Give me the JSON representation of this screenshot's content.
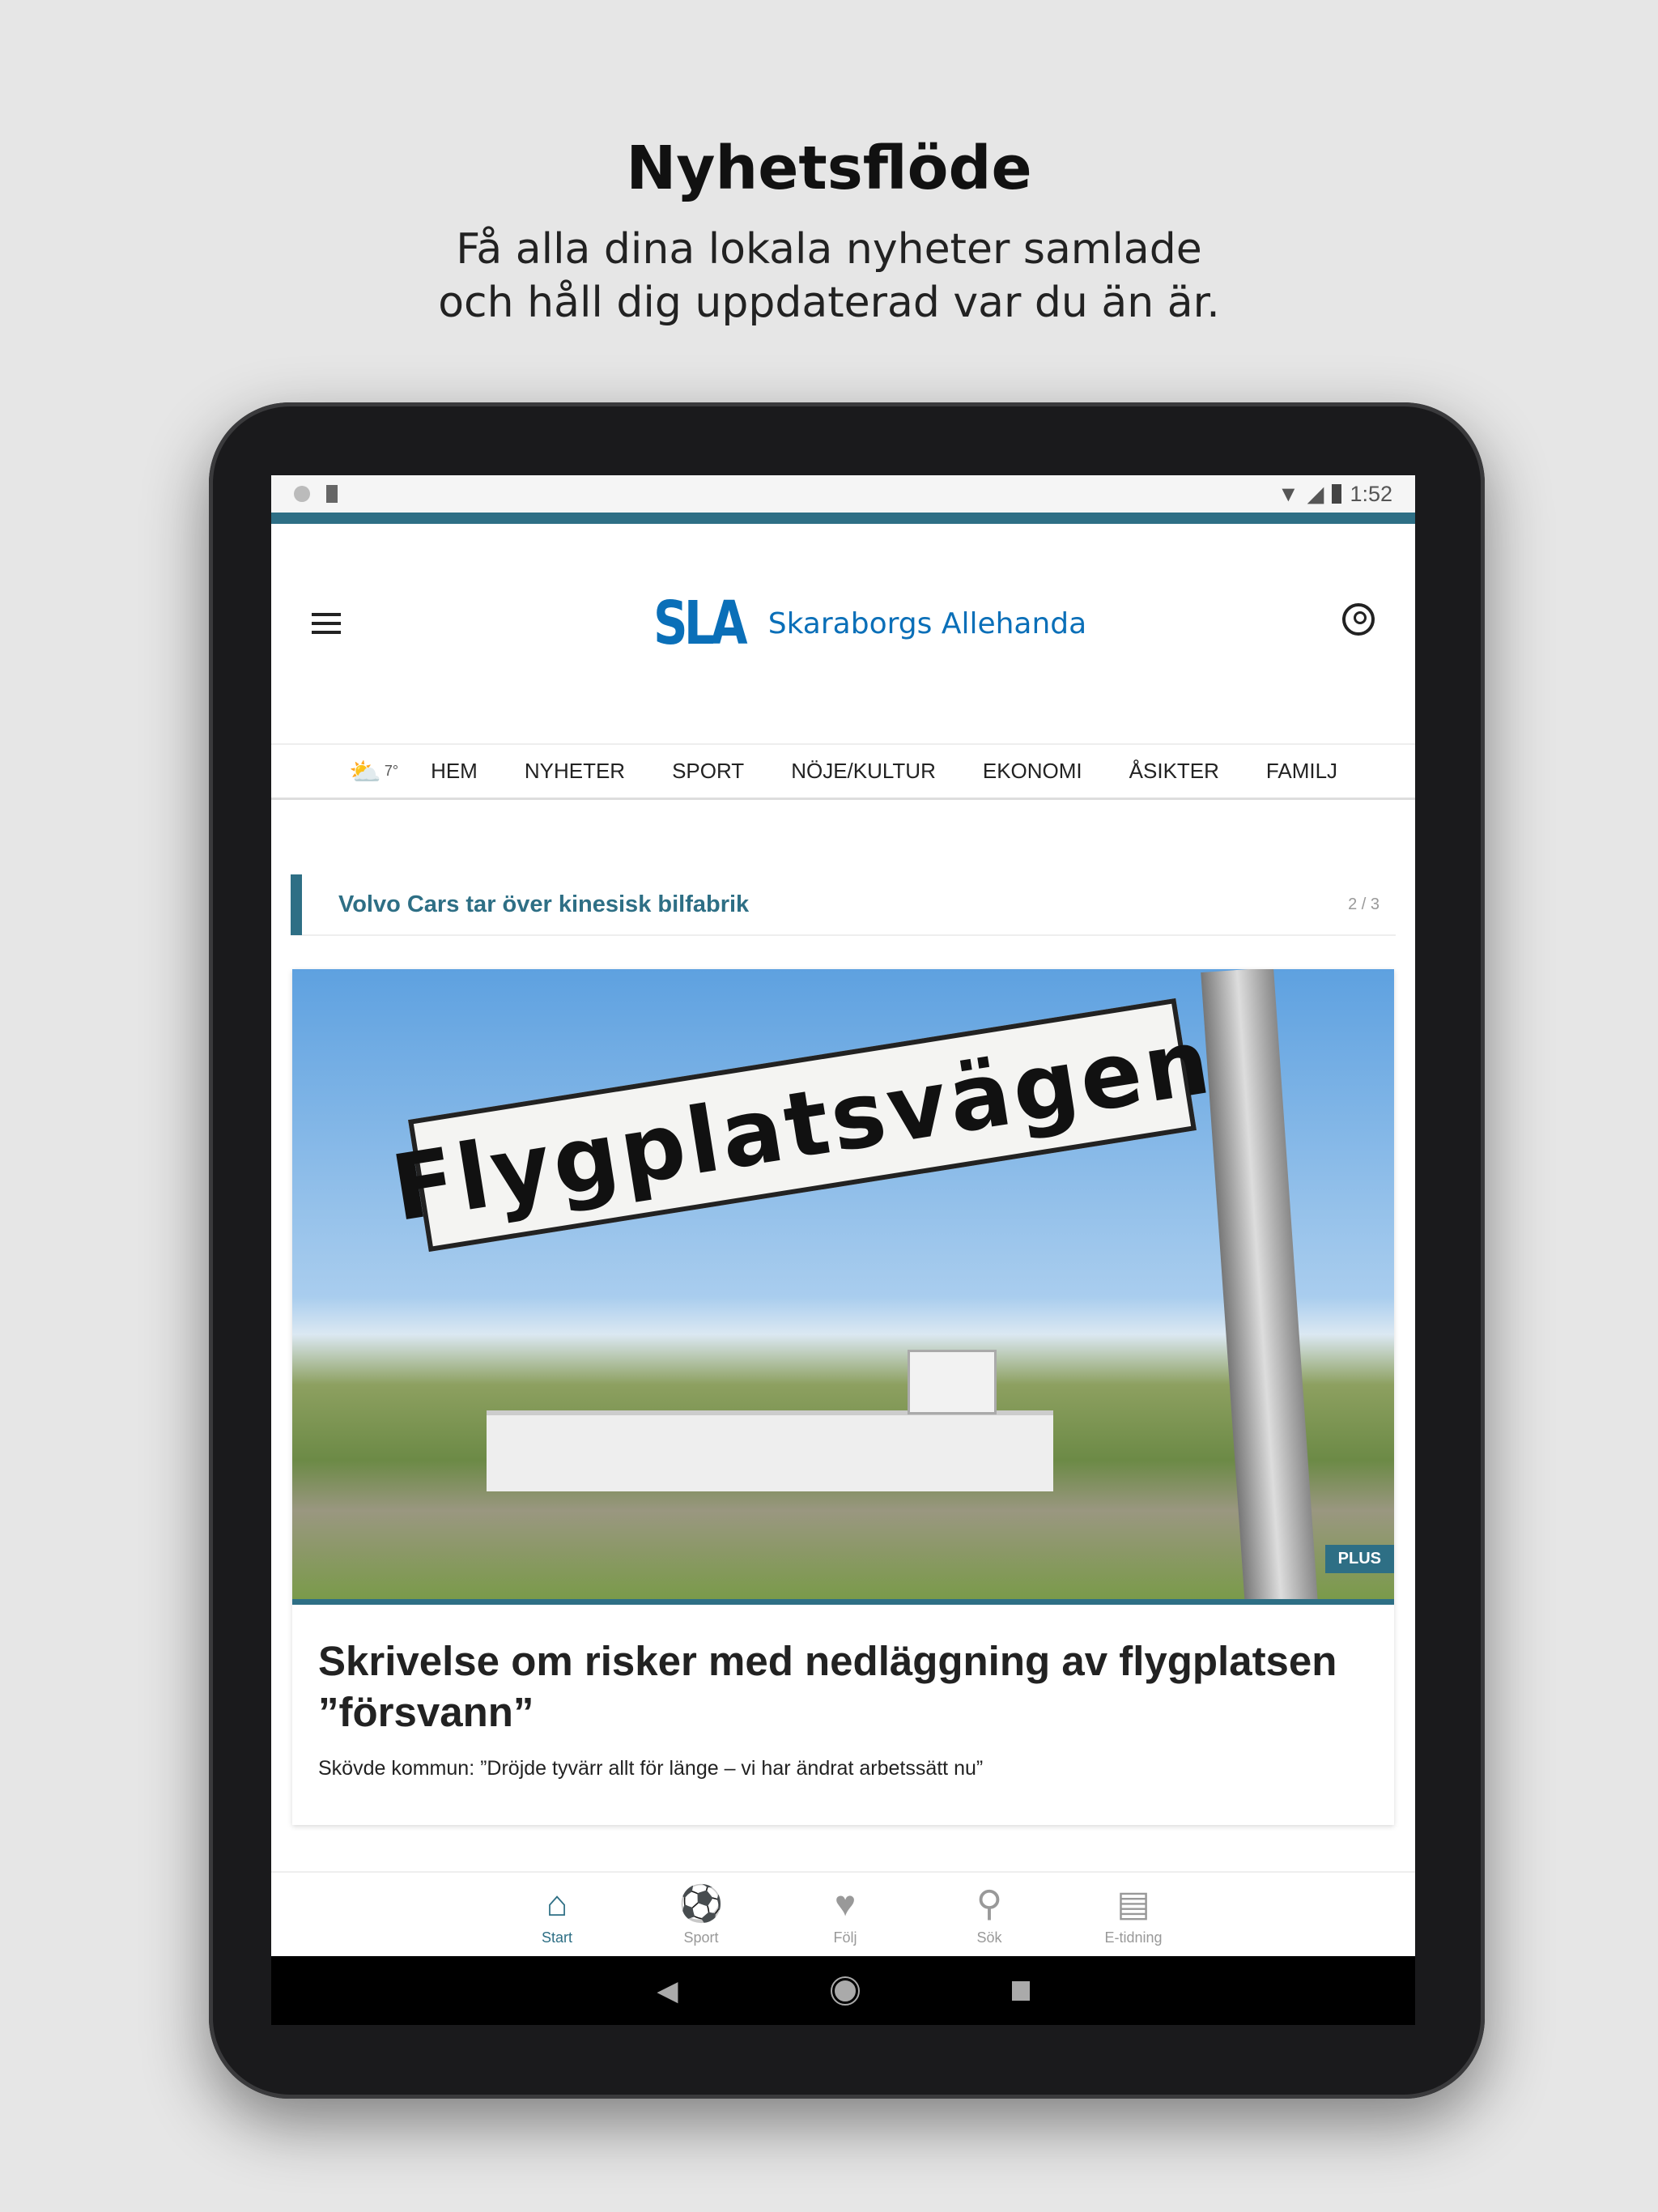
{
  "promo": {
    "title": "Nyhetsflöde",
    "subtitle_line1": "Få alla dina lokala nyheter samlade",
    "subtitle_line2": "och håll dig uppdaterad var du än är."
  },
  "status_bar": {
    "time": "1:52"
  },
  "header": {
    "logo_mark": "SLA",
    "logo_text": "Skaraborgs Allehanda"
  },
  "nav": {
    "weather_temp": "7°",
    "items": [
      "HEM",
      "NYHETER",
      "SPORT",
      "NÖJE/KULTUR",
      "EKONOMI",
      "ÅSIKTER",
      "FAMILJ"
    ]
  },
  "ticker": {
    "text": "Volvo Cars tar över kinesisk bilfabrik",
    "pager": "2 / 3"
  },
  "article": {
    "image_sign_text": "Flygplatsvägen",
    "badge": "PLUS",
    "headline": "Skrivelse om risker med nedläggning av flygplatsen ”försvann”",
    "subheadline": "Skövde kommun: ”Dröjde tyvärr allt för länge – vi har ändrat arbetssätt nu”"
  },
  "bottom_nav": {
    "items": [
      {
        "label": "Start",
        "icon": "home-icon",
        "active": true
      },
      {
        "label": "Sport",
        "icon": "soccer-ball-icon"
      },
      {
        "label": "Följ",
        "icon": "heart-icon"
      },
      {
        "label": "Sök",
        "icon": "search-icon"
      },
      {
        "label": "E-tidning",
        "icon": "newspaper-icon"
      }
    ]
  },
  "colors": {
    "accent": "#2e6f85",
    "brand": "#0a6fb8"
  }
}
